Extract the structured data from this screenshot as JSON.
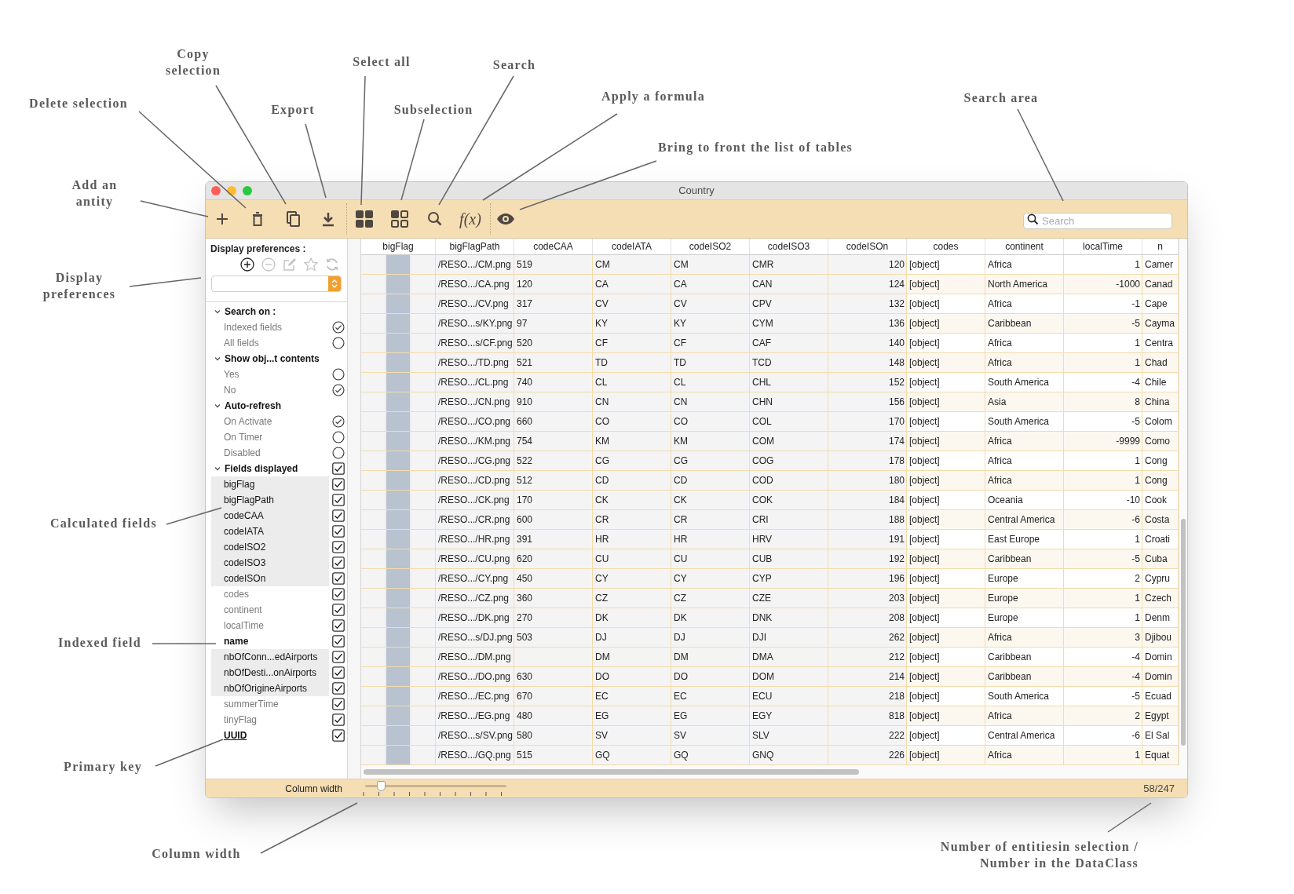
{
  "annotations": [
    {
      "text": "Delete selection"
    },
    {
      "text": "Copy selection"
    },
    {
      "text": "Export"
    },
    {
      "text": "Select all"
    },
    {
      "text": "Subselection"
    },
    {
      "text": "Search"
    },
    {
      "text": "Apply a formula"
    },
    {
      "text": "Bring to front the list of tables"
    },
    {
      "text": "Search area"
    },
    {
      "text": "Add an antity"
    },
    {
      "text": "Display preferences"
    },
    {
      "text": "Calculated fields"
    },
    {
      "text": "Indexed field"
    },
    {
      "text": "Primary key"
    },
    {
      "text": "Column width"
    },
    {
      "text": "Number of entitiesin selection / Number in the DataClass"
    }
  ],
  "window": {
    "title": "Country"
  },
  "toolbar": {
    "formula_label": "f(x)",
    "search": {
      "placeholder": "Search"
    }
  },
  "sidebar": {
    "title": "Display preferences :",
    "sections": [
      {
        "title": "Search on :",
        "expanded": true,
        "kind": "radio",
        "options": [
          {
            "label": "Indexed fields",
            "selected": true
          },
          {
            "label": "All fields",
            "selected": false
          }
        ]
      },
      {
        "title": "Show obj...t contents",
        "expanded": true,
        "kind": "radio",
        "options": [
          {
            "label": "Yes",
            "selected": false
          },
          {
            "label": "No",
            "selected": true
          }
        ]
      },
      {
        "title": "Auto-refresh",
        "expanded": true,
        "kind": "radio",
        "options": [
          {
            "label": "On Activate",
            "selected": true
          },
          {
            "label": "On Timer",
            "selected": false
          },
          {
            "label": "Disabled",
            "selected": false
          }
        ]
      },
      {
        "title": "Fields displayed",
        "expanded": true,
        "kind": "checkbox",
        "checked": true,
        "options": [
          {
            "label": "bigFlag",
            "checked": true,
            "kind": "calculated"
          },
          {
            "label": "bigFlagPath",
            "checked": true,
            "kind": "calculated"
          },
          {
            "label": "codeCAA",
            "checked": true,
            "kind": "calculated"
          },
          {
            "label": "codeIATA",
            "checked": true,
            "kind": "calculated"
          },
          {
            "label": "codeISO2",
            "checked": true,
            "kind": "calculated"
          },
          {
            "label": "codeISO3",
            "checked": true,
            "kind": "calculated"
          },
          {
            "label": "codeISOn",
            "checked": true,
            "kind": "calculated"
          },
          {
            "label": "codes",
            "checked": true,
            "kind": "plain"
          },
          {
            "label": "continent",
            "checked": true,
            "kind": "plain"
          },
          {
            "label": "localTime",
            "checked": true,
            "kind": "plain"
          },
          {
            "label": "name",
            "checked": true,
            "kind": "indexed"
          },
          {
            "label": "nbOfConn...edAirports",
            "checked": true,
            "kind": "calculated"
          },
          {
            "label": "nbOfDesti...onAirports",
            "checked": true,
            "kind": "calculated"
          },
          {
            "label": "nbOfOrigineAirports",
            "checked": true,
            "kind": "calculated"
          },
          {
            "label": "summerTime",
            "checked": true,
            "kind": "plain"
          },
          {
            "label": "tinyFlag",
            "checked": true,
            "kind": "plain"
          },
          {
            "label": "UUID",
            "checked": true,
            "kind": "primary"
          }
        ]
      }
    ]
  },
  "table": {
    "columns": [
      {
        "label": "bigFlag",
        "kind": "image"
      },
      {
        "label": "bigFlagPath",
        "kind": "text"
      },
      {
        "label": "codeCAA",
        "kind": "text"
      },
      {
        "label": "codeIATA",
        "kind": "text"
      },
      {
        "label": "codeISO2",
        "kind": "text"
      },
      {
        "label": "codeISO3",
        "kind": "text"
      },
      {
        "label": "codeISOn",
        "kind": "number"
      },
      {
        "label": "codes",
        "kind": "text"
      },
      {
        "label": "continent",
        "kind": "text"
      },
      {
        "label": "localTime",
        "kind": "number"
      },
      {
        "label": "n",
        "kind": "text"
      }
    ],
    "rows": [
      {
        "cells": [
          "",
          "/RESO.../CM.png",
          "519",
          "CM",
          "CM",
          "CMR",
          "120",
          "[object]",
          "Africa",
          "1",
          "Camer"
        ]
      },
      {
        "cells": [
          "",
          "/RESO.../CA.png",
          "120",
          "CA",
          "CA",
          "CAN",
          "124",
          "[object]",
          "North America",
          "-1000",
          "Canad"
        ]
      },
      {
        "cells": [
          "",
          "/RESO.../CV.png",
          "317",
          "CV",
          "CV",
          "CPV",
          "132",
          "[object]",
          "Africa",
          "-1",
          "Cape"
        ]
      },
      {
        "cells": [
          "",
          "/RESO...s/KY.png",
          "97",
          "KY",
          "KY",
          "CYM",
          "136",
          "[object]",
          "Caribbean",
          "-5",
          "Cayma"
        ]
      },
      {
        "cells": [
          "",
          "/RESO...s/CF.png",
          "520",
          "CF",
          "CF",
          "CAF",
          "140",
          "[object]",
          "Africa",
          "1",
          "Centra"
        ]
      },
      {
        "cells": [
          "",
          "/RESO.../TD.png",
          "521",
          "TD",
          "TD",
          "TCD",
          "148",
          "[object]",
          "Africa",
          "1",
          "Chad"
        ]
      },
      {
        "cells": [
          "",
          "/RESO.../CL.png",
          "740",
          "CL",
          "CL",
          "CHL",
          "152",
          "[object]",
          "South America",
          "-4",
          "Chile"
        ]
      },
      {
        "cells": [
          "",
          "/RESO.../CN.png",
          "910",
          "CN",
          "CN",
          "CHN",
          "156",
          "[object]",
          "Asia",
          "8",
          "China"
        ]
      },
      {
        "cells": [
          "",
          "/RESO.../CO.png",
          "660",
          "CO",
          "CO",
          "COL",
          "170",
          "[object]",
          "South America",
          "-5",
          "Colom"
        ]
      },
      {
        "cells": [
          "",
          "/RESO.../KM.png",
          "754",
          "KM",
          "KM",
          "COM",
          "174",
          "[object]",
          "Africa",
          "-9999",
          "Como"
        ]
      },
      {
        "cells": [
          "",
          "/RESO.../CG.png",
          "522",
          "CG",
          "CG",
          "COG",
          "178",
          "[object]",
          "Africa",
          "1",
          "Cong"
        ]
      },
      {
        "cells": [
          "",
          "/RESO.../CD.png",
          "512",
          "CD",
          "CD",
          "COD",
          "180",
          "[object]",
          "Africa",
          "1",
          "Cong"
        ]
      },
      {
        "cells": [
          "",
          "/RESO.../CK.png",
          "170",
          "CK",
          "CK",
          "COK",
          "184",
          "[object]",
          "Oceania",
          "-10",
          "Cook"
        ]
      },
      {
        "cells": [
          "",
          "/RESO.../CR.png",
          "600",
          "CR",
          "CR",
          "CRI",
          "188",
          "[object]",
          "Central America",
          "-6",
          "Costa"
        ]
      },
      {
        "cells": [
          "",
          "/RESO.../HR.png",
          "391",
          "HR",
          "HR",
          "HRV",
          "191",
          "[object]",
          "East Europe",
          "1",
          "Croati"
        ]
      },
      {
        "cells": [
          "",
          "/RESO.../CU.png",
          "620",
          "CU",
          "CU",
          "CUB",
          "192",
          "[object]",
          "Caribbean",
          "-5",
          "Cuba"
        ]
      },
      {
        "cells": [
          "",
          "/RESO.../CY.png",
          "450",
          "CY",
          "CY",
          "CYP",
          "196",
          "[object]",
          "Europe",
          "2",
          "Cypru"
        ]
      },
      {
        "cells": [
          "",
          "/RESO.../CZ.png",
          "360",
          "CZ",
          "CZ",
          "CZE",
          "203",
          "[object]",
          "Europe",
          "1",
          "Czech"
        ]
      },
      {
        "cells": [
          "",
          "/RESO.../DK.png",
          "270",
          "DK",
          "DK",
          "DNK",
          "208",
          "[object]",
          "Europe",
          "1",
          "Denm"
        ]
      },
      {
        "cells": [
          "",
          "/RESO...s/DJ.png",
          "503",
          "DJ",
          "DJ",
          "DJI",
          "262",
          "[object]",
          "Africa",
          "3",
          "Djibou"
        ]
      },
      {
        "cells": [
          "",
          "/RESO.../DM.png",
          null,
          "DM",
          "DM",
          "DMA",
          "212",
          "[object]",
          "Caribbean",
          "-4",
          "Domin"
        ]
      },
      {
        "cells": [
          "",
          "/RESO.../DO.png",
          "630",
          "DO",
          "DO",
          "DOM",
          "214",
          "[object]",
          "Caribbean",
          "-4",
          "Domin"
        ]
      },
      {
        "cells": [
          "",
          "/RESO.../EC.png",
          "670",
          "EC",
          "EC",
          "ECU",
          "218",
          "[object]",
          "South America",
          "-5",
          "Ecuad"
        ]
      },
      {
        "cells": [
          "",
          "/RESO.../EG.png",
          "480",
          "EG",
          "EG",
          "EGY",
          "818",
          "[object]",
          "Africa",
          "2",
          "Egypt"
        ]
      },
      {
        "cells": [
          "",
          "/RESO...s/SV.png",
          "580",
          "SV",
          "SV",
          "SLV",
          "222",
          "[object]",
          "Central America",
          "-6",
          "El Sal"
        ]
      },
      {
        "cells": [
          "",
          "/RESO.../GQ.png",
          "515",
          "GQ",
          "GQ",
          "GNQ",
          "226",
          "[object]",
          "Africa",
          "1",
          "Equat"
        ]
      }
    ]
  },
  "status_bar": {
    "label": "Column width",
    "slider": {
      "level": 0.11
    },
    "count": "58/247"
  }
}
